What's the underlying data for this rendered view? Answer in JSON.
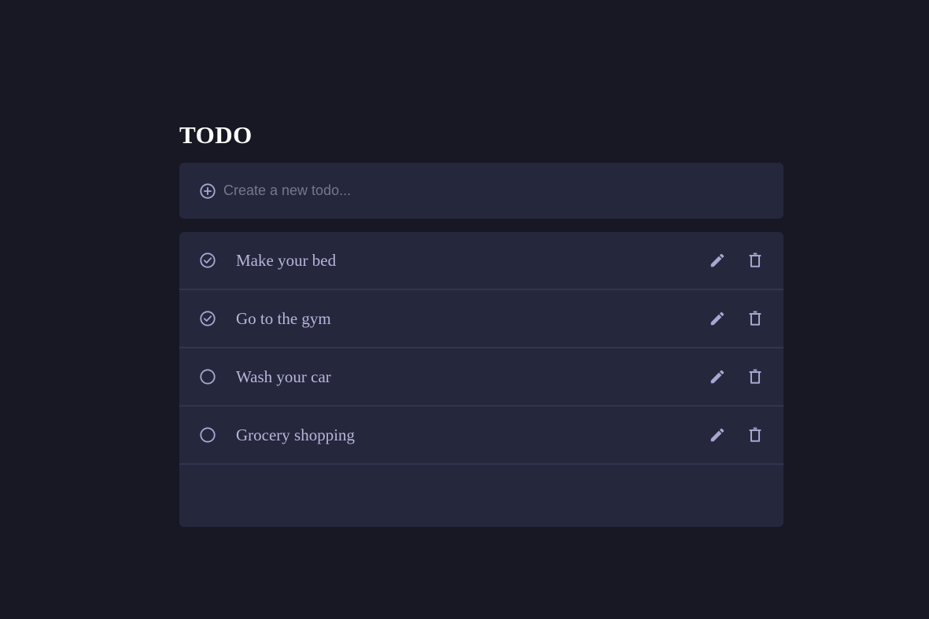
{
  "header": {
    "title": "TODO"
  },
  "new_todo": {
    "placeholder": "Create a new todo...",
    "value": "",
    "icon": "plus-circle-icon"
  },
  "todos": [
    {
      "text": "Make your bed",
      "completed": true
    },
    {
      "text": "Go to the gym",
      "completed": true
    },
    {
      "text": "Wash your car",
      "completed": false
    },
    {
      "text": "Grocery shopping",
      "completed": false
    }
  ],
  "icons": {
    "check": "check-circle-icon",
    "unchecked": "circle-icon",
    "edit": "pencil-icon",
    "delete": "trash-icon"
  },
  "colors": {
    "background": "#181824",
    "card": "#25273c",
    "divider": "#333550",
    "accent": "#a9a6d2",
    "text": "#b8b5dc",
    "title": "#ffffff",
    "placeholder": "#77778a"
  }
}
